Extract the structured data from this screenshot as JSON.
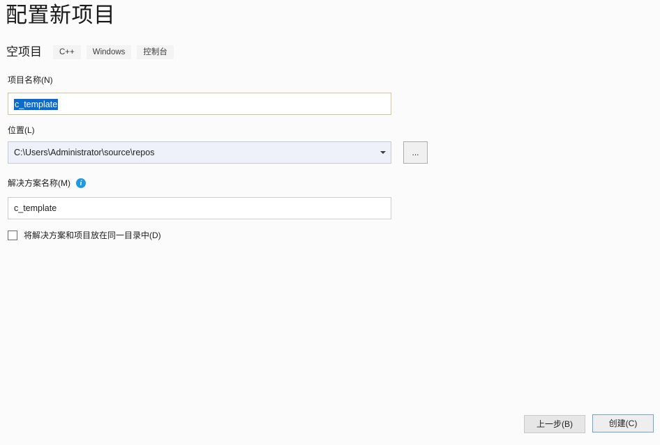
{
  "dialog": {
    "title": "配置新项目"
  },
  "template": {
    "name": "空项目",
    "tags": [
      "C++",
      "Windows",
      "控制台"
    ]
  },
  "fields": {
    "project_name": {
      "label": "项目名称(N)",
      "value": "c_template",
      "selected": true
    },
    "location": {
      "label": "位置(L)",
      "value": "C:\\Users\\Administrator\\source\\repos",
      "browse_label": "...",
      "dropdown_icon": "chevron-down-icon"
    },
    "solution_name": {
      "label": "解决方案名称(M)",
      "value": "c_template",
      "info_icon": "info-icon"
    },
    "same_directory": {
      "label": "将解决方案和项目放在同一目录中(D)",
      "checked": false
    }
  },
  "footer": {
    "back_label": "上一步(B)",
    "create_label": "创建(C)"
  },
  "colors": {
    "background": "#fbfbfb",
    "selection_blue": "#0a6bce",
    "focus_border": "#d2c49a",
    "combo_background": "#eef1f9",
    "accent_blue": "#6ea4d4",
    "info_blue": "#1e9ae0"
  }
}
